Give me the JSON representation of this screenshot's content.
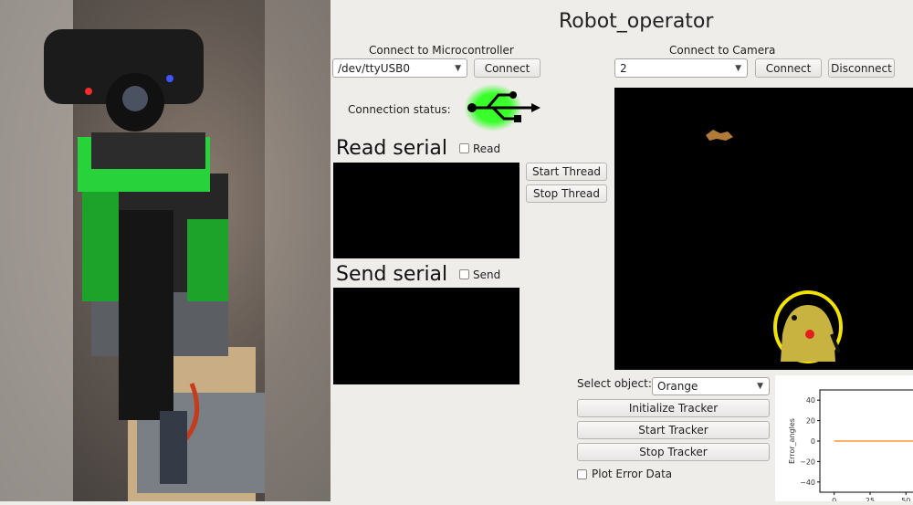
{
  "window": {
    "title": "Robot_operator"
  },
  "micro": {
    "section_label": "Connect to Microcontroller",
    "port_value": "/dev/ttyUSB0",
    "connect_label": "Connect",
    "status_label": "Connection status:"
  },
  "camera": {
    "section_label": "Connect to Camera",
    "index_value": "2",
    "connect_label": "Connect",
    "disconnect_label": "Disconnect"
  },
  "read": {
    "heading": "Read serial",
    "checkbox_label": "Read",
    "start_thread_label": "Start Thread",
    "stop_thread_label": "Stop Thread"
  },
  "send": {
    "heading": "Send serial",
    "checkbox_label": "Send"
  },
  "tracker": {
    "select_label": "Select object:",
    "object_value": "Orange",
    "init_label": "Initialize Tracker",
    "start_label": "Start Tracker",
    "stop_label": "Stop Tracker",
    "plot_label": "Plot Error Data"
  },
  "chart_data": {
    "type": "line",
    "ylabel": "Error_angles",
    "xlabel": "",
    "ylim": [
      -50,
      50
    ],
    "xlim": [
      -10,
      60
    ],
    "yticks": [
      "40",
      "20",
      "0",
      "−20",
      "−40"
    ],
    "ytick_values": [
      40,
      20,
      0,
      -20,
      -40
    ],
    "xticks": [
      "0",
      "25",
      "50"
    ],
    "xtick_values": [
      0,
      25,
      50
    ],
    "series": [
      {
        "x": [
          0,
          60
        ],
        "y": [
          0,
          0
        ],
        "color": "#ff7f0e"
      }
    ]
  },
  "colors": {
    "usb_glow": "#39ff2a",
    "background": "#efedea"
  },
  "icons": {
    "status": "usb-icon"
  }
}
